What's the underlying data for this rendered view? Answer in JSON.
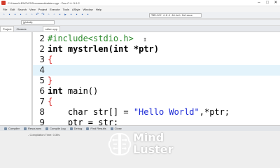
{
  "window": {
    "title": "C:\\Users\\LENOVO\\Documents\\strlen.cpp - Dev-C++ 5.9.2",
    "controls": [
      "–",
      "□",
      "✕"
    ]
  },
  "menu": [
    "File",
    "Edit",
    "Search",
    "View",
    "Project",
    "Execute",
    "Tools",
    "AStyle",
    "Window",
    "Help"
  ],
  "toolbar": {
    "compiler": "TDM-GCC 4.8.1 64-bit Release",
    "globals": "(globals)"
  },
  "panel_tabs": [
    "Project",
    "Classes"
  ],
  "file_tab": "strlen.cpp",
  "editor": {
    "lines": [
      {
        "num": "2",
        "fold": "",
        "tokens": [
          {
            "t": "#include<stdio.h>",
            "c": "pre"
          }
        ]
      },
      {
        "num": "2",
        "fold": "",
        "tokens": [
          {
            "t": "int ",
            "c": "kw"
          },
          {
            "t": "mystrlen(",
            "c": "kw"
          },
          {
            "t": "int ",
            "c": "kw"
          },
          {
            "t": "*ptr)",
            "c": "kw"
          }
        ]
      },
      {
        "num": "3",
        "fold": "",
        "tokens": [
          {
            "t": "{",
            "c": "brace"
          }
        ]
      },
      {
        "num": "4",
        "fold": "",
        "tokens": []
      },
      {
        "num": "5",
        "fold": "",
        "tokens": [
          {
            "t": "}",
            "c": "brace"
          }
        ]
      },
      {
        "num": "6",
        "fold": "",
        "tokens": [
          {
            "t": "int ",
            "c": "kw"
          },
          {
            "t": "main()",
            "c": "plain"
          }
        ]
      },
      {
        "num": "7",
        "fold": "",
        "tokens": [
          {
            "t": "{",
            "c": "brace"
          }
        ]
      },
      {
        "num": "8",
        "fold": "",
        "tokens": [
          {
            "t": "    char ",
            "c": "plain"
          },
          {
            "t": "str[] = ",
            "c": "plain"
          },
          {
            "t": "\"Hello World\"",
            "c": "str"
          },
          {
            "t": ",*ptr;",
            "c": "plain"
          }
        ]
      },
      {
        "num": "9",
        "fold": "",
        "tokens": [
          {
            "t": "    ptr = str;",
            "c": "plain"
          }
        ]
      }
    ]
  },
  "bottom_tabs": [
    "Compiler",
    "Resources",
    "Compile Log",
    "Debug",
    "Find Results",
    "Close"
  ],
  "output": "- Compilation Time: 0.39s",
  "watermark": {
    "line1": "Mind",
    "line2": "Luster"
  }
}
